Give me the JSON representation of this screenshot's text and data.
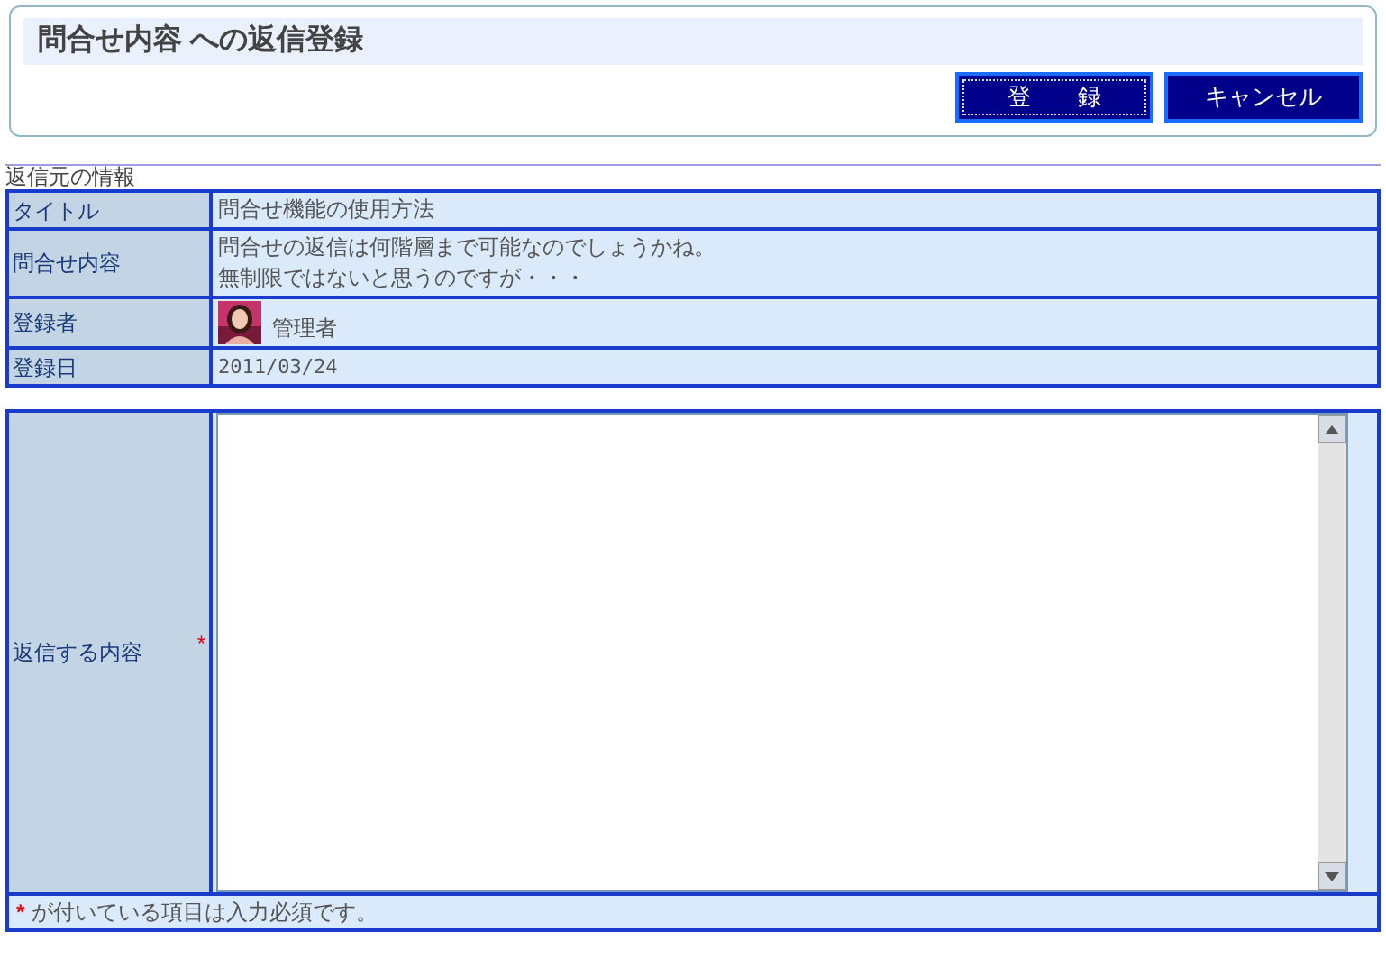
{
  "header": {
    "title": "問合せ内容 への返信登録",
    "buttons": [
      {
        "label": "登　　録",
        "kind": "primary"
      },
      {
        "label": "キャンセル",
        "kind": "normal"
      }
    ]
  },
  "source_info": {
    "caption": "返信元の情報",
    "rows": [
      {
        "label": "タイトル",
        "kind": "text",
        "lines": [
          "問合せ機能の使用方法"
        ]
      },
      {
        "label": "問合せ内容",
        "kind": "text",
        "lines": [
          "問合せの返信は何階層まで可能なのでしょうかね。",
          "無制限ではないと思うのですが・・・"
        ]
      },
      {
        "label": "登録者",
        "kind": "user",
        "lines": [
          "管理者"
        ]
      },
      {
        "label": "登録日",
        "kind": "date",
        "lines": [
          "2011/03/24"
        ]
      }
    ]
  },
  "reply_form": {
    "label": "返信する内容",
    "required_mark": "*",
    "note_mark": "*",
    "note": "が付いている項目は入力必須です。"
  }
}
